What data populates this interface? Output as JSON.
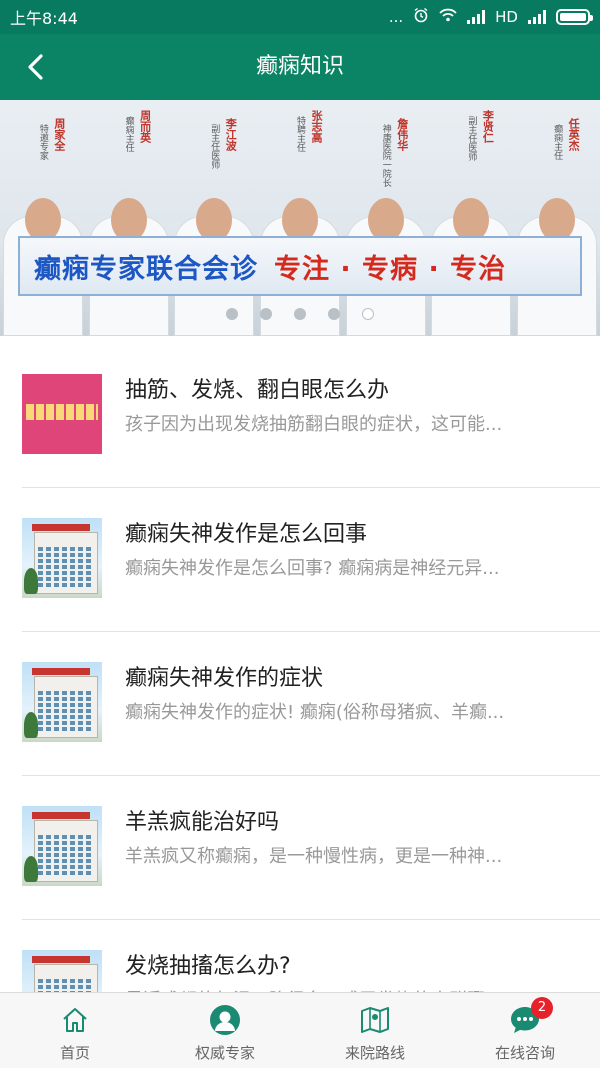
{
  "status_bar": {
    "time": "上午8:44",
    "dots": "...",
    "network": "HD",
    "icons": [
      "alarm-icon",
      "wifi-icon",
      "signal-icon",
      "battery-icon"
    ]
  },
  "nav": {
    "title": "癫痫知识",
    "back_icon": "chevron-left-icon"
  },
  "banner": {
    "headline": "癫痫专家联合会诊",
    "slogan": "专注 · 专病 · 专治",
    "doctors": [
      {
        "name": "周家全",
        "role": "特邀专家"
      },
      {
        "name": "周而英",
        "role": "癫痫主任"
      },
      {
        "name": "李江波",
        "role": "副主任医师"
      },
      {
        "name": "张志高",
        "role": "特聘主任"
      },
      {
        "name": "詹伟华",
        "role": "神康医院一院长"
      },
      {
        "name": "李贤仁",
        "role": "副主任医师"
      },
      {
        "name": "任英杰",
        "role": "癫痫主任"
      }
    ],
    "slide_count": 5,
    "active_slide": 5
  },
  "articles": [
    {
      "title": "抽筋、发烧、翻白眼怎么办",
      "desc": "孩子因为出现发烧抽筋翻白眼的症状，这可能...",
      "thumb": "pink"
    },
    {
      "title": "癫痫失神发作是怎么回事",
      "desc": "癫痫失神发作是怎么回事? 癫痫病是神经元异...",
      "thumb": "building"
    },
    {
      "title": "癫痫失神发作的症状",
      "desc": "癫痫失神发作的症状! 癫痫(俗称母猪疯、羊癫...",
      "thumb": "building"
    },
    {
      "title": "羊羔疯能治好吗",
      "desc": "羊羔疯又称癫痫，是一种慢性病，更是一种神...",
      "thumb": "building"
    },
    {
      "title": "发烧抽搐怎么办?",
      "desc": "最近成都的气温下降很多，感冒发烧的人群骤...",
      "thumb": "building"
    }
  ],
  "tab_bar": {
    "tabs": [
      {
        "label": "首页",
        "icon": "home-icon"
      },
      {
        "label": "权威专家",
        "icon": "expert-avatar-icon"
      },
      {
        "label": "来院路线",
        "icon": "map-icon"
      },
      {
        "label": "在线咨询",
        "icon": "chat-icon",
        "badge": "2"
      }
    ]
  },
  "colors": {
    "primary": "#0a8464",
    "status_bar": "#087a5f",
    "badge": "#e8202a",
    "text_secondary": "#999999"
  }
}
